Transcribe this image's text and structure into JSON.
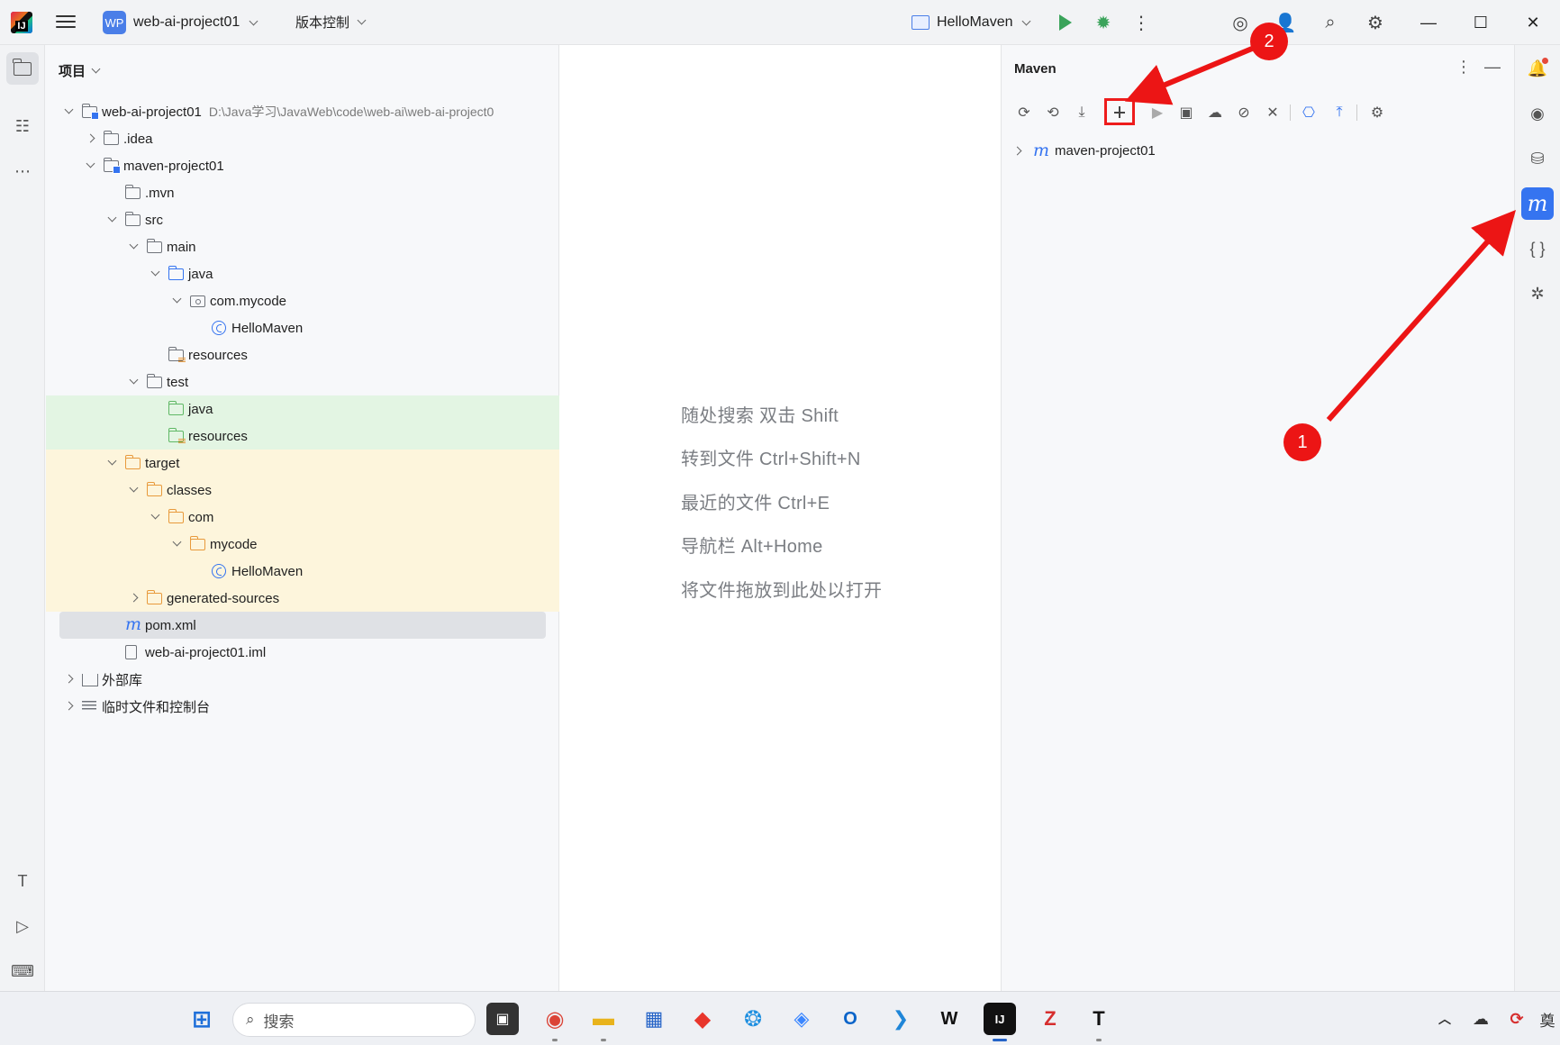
{
  "titlebar": {
    "project_badge": "WP",
    "project_name": "web-ai-project01",
    "vcs_label": "版本控制",
    "run_config": "HelloMaven"
  },
  "project_panel": {
    "header": "项目",
    "tree": [
      {
        "label": "web-ai-project01",
        "path": "D:\\Java学习\\JavaWeb\\code\\web-ai\\web-ai-project0",
        "depth": 0,
        "arrow": "down",
        "icon": "module",
        "bold": true
      },
      {
        "label": ".idea",
        "depth": 1,
        "arrow": "right",
        "icon": "folder"
      },
      {
        "label": "maven-project01",
        "depth": 1,
        "arrow": "down",
        "icon": "module",
        "bold": true
      },
      {
        "label": ".mvn",
        "depth": 2,
        "arrow": "",
        "icon": "folder"
      },
      {
        "label": "src",
        "depth": 2,
        "arrow": "down",
        "icon": "folder"
      },
      {
        "label": "main",
        "depth": 3,
        "arrow": "down",
        "icon": "folder"
      },
      {
        "label": "java",
        "depth": 4,
        "arrow": "down",
        "icon": "folder-blue"
      },
      {
        "label": "com.mycode",
        "depth": 5,
        "arrow": "down",
        "icon": "package"
      },
      {
        "label": "HelloMaven",
        "depth": 6,
        "arrow": "",
        "icon": "class"
      },
      {
        "label": "resources",
        "depth": 4,
        "arrow": "",
        "icon": "resources"
      },
      {
        "label": "test",
        "depth": 3,
        "arrow": "down",
        "icon": "folder"
      },
      {
        "label": "java",
        "depth": 4,
        "arrow": "",
        "icon": "folder-green",
        "bg": "green"
      },
      {
        "label": "resources",
        "depth": 4,
        "arrow": "",
        "icon": "resources-green",
        "bg": "green"
      },
      {
        "label": "target",
        "depth": 2,
        "arrow": "down",
        "icon": "folder-orange",
        "bg": "yellow"
      },
      {
        "label": "classes",
        "depth": 3,
        "arrow": "down",
        "icon": "folder-orange",
        "bg": "yellow"
      },
      {
        "label": "com",
        "depth": 4,
        "arrow": "down",
        "icon": "folder-orange",
        "bg": "yellow"
      },
      {
        "label": "mycode",
        "depth": 5,
        "arrow": "down",
        "icon": "folder-orange",
        "bg": "yellow"
      },
      {
        "label": "HelloMaven",
        "depth": 6,
        "arrow": "",
        "icon": "class",
        "bg": "yellow"
      },
      {
        "label": "generated-sources",
        "depth": 3,
        "arrow": "right",
        "icon": "folder-orange",
        "bg": "yellow"
      },
      {
        "label": "pom.xml",
        "depth": 2,
        "arrow": "",
        "icon": "maven",
        "selected": true
      },
      {
        "label": "web-ai-project01.iml",
        "depth": 2,
        "arrow": "",
        "icon": "file"
      },
      {
        "label": "外部库",
        "depth": 0,
        "arrow": "right",
        "icon": "library"
      },
      {
        "label": "临时文件和控制台",
        "depth": 0,
        "arrow": "right",
        "icon": "scratch"
      }
    ]
  },
  "editor": {
    "hints": [
      "随处搜索 双击 Shift",
      "转到文件 Ctrl+Shift+N",
      "最近的文件 Ctrl+E",
      "导航栏 Alt+Home",
      "将文件拖放到此处以打开"
    ]
  },
  "maven_panel": {
    "title": "Maven",
    "project": "maven-project01"
  },
  "taskbar": {
    "search_placeholder": "搜索",
    "tray_char": "奠"
  },
  "annotations": {
    "badge1": "1",
    "badge2": "2",
    "color": "#ec1515"
  }
}
